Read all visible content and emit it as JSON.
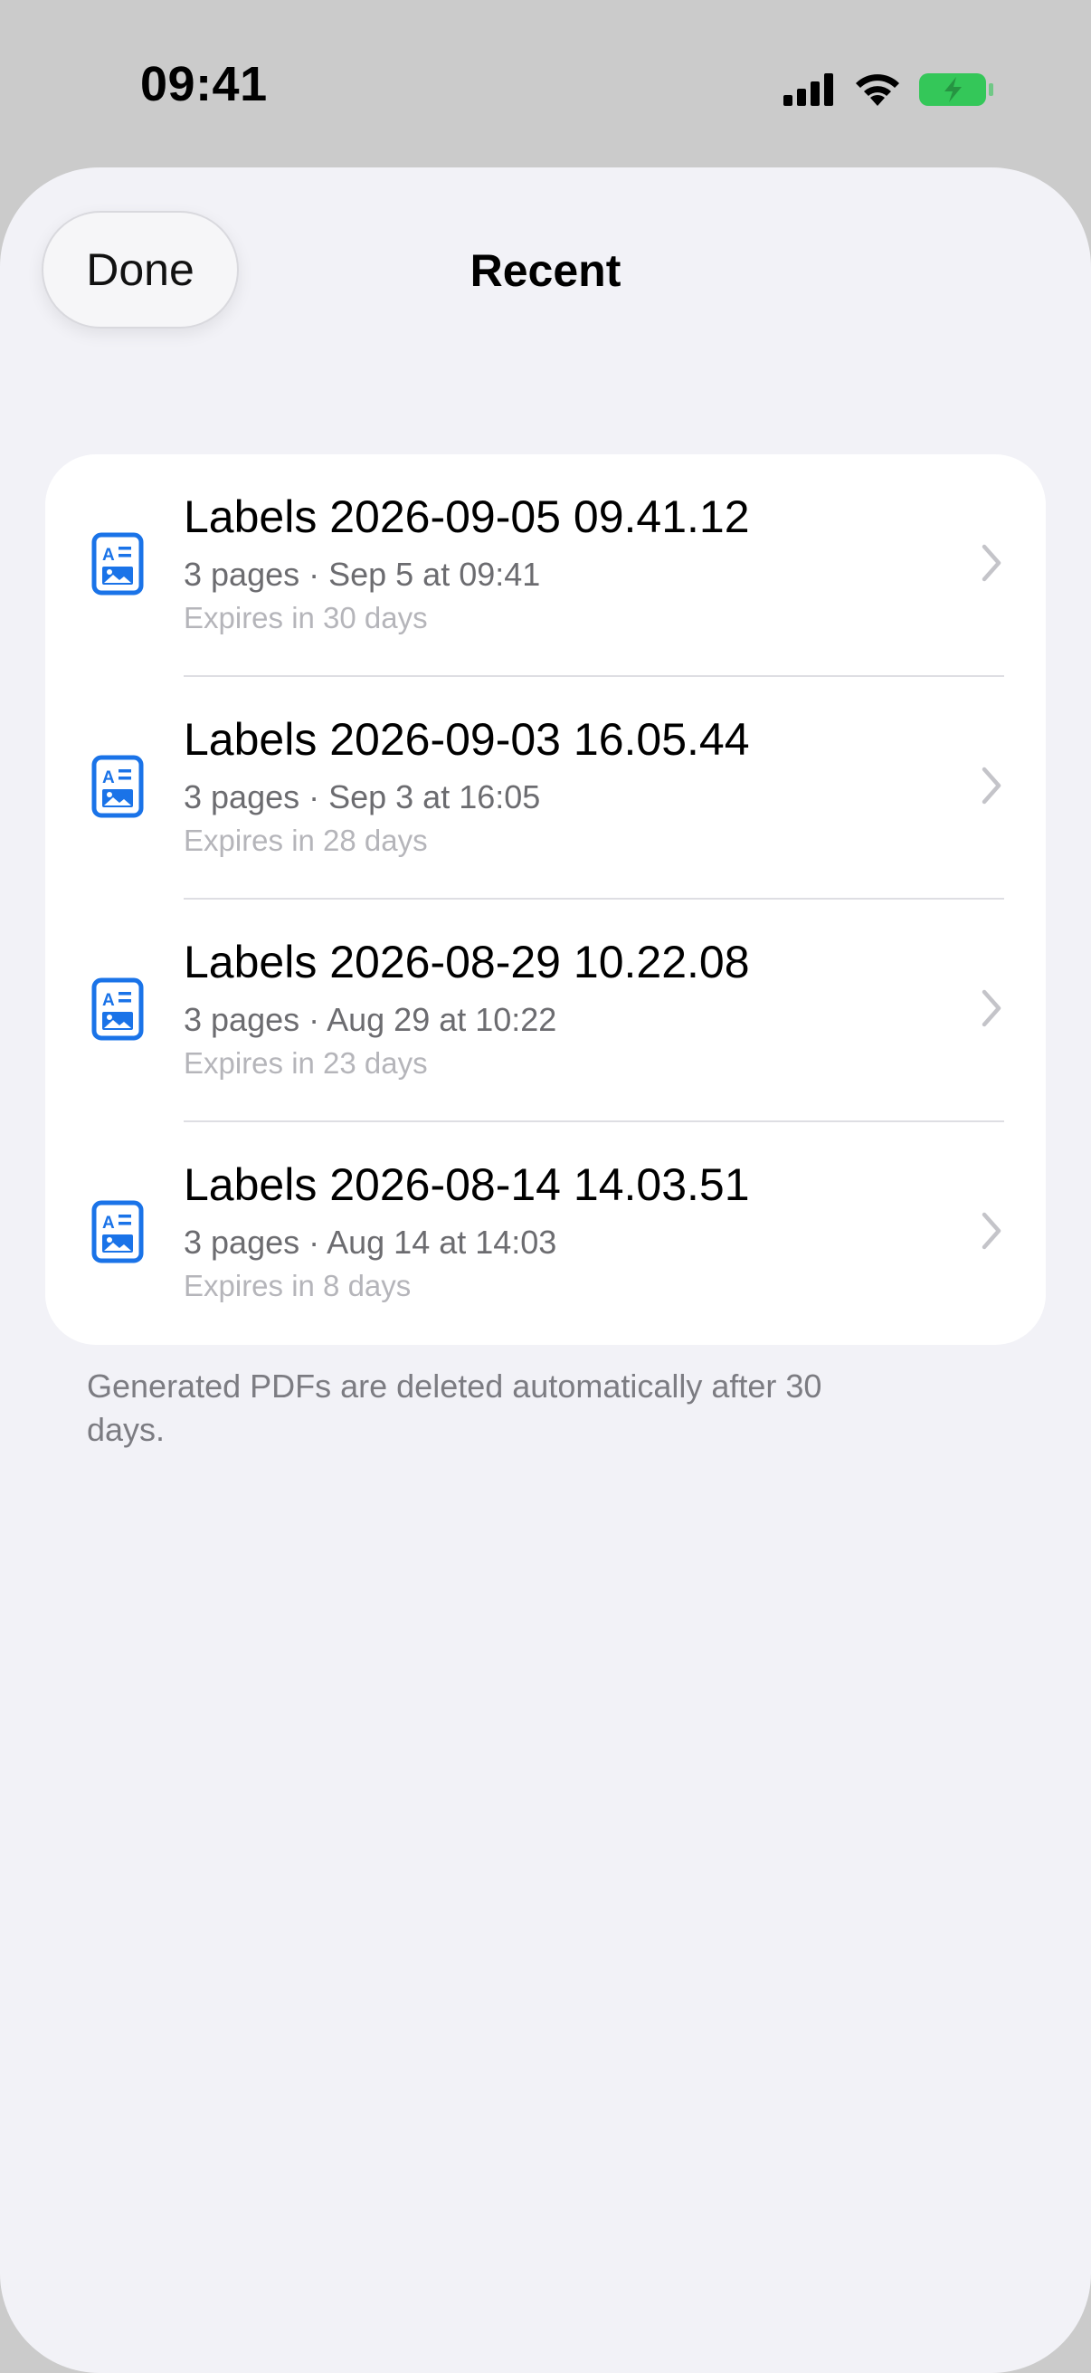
{
  "status_bar": {
    "time": "09:41",
    "battery_color": "#34c759"
  },
  "sheet": {
    "done_label": "Done",
    "title": "Recent"
  },
  "items": [
    {
      "title": "Labels 2026-09-05 09.41.12",
      "subtitle": "3 pages · Sep 5 at 09:41",
      "expiry": "Expires in 30 days"
    },
    {
      "title": "Labels 2026-09-03 16.05.44",
      "subtitle": "3 pages · Sep 3 at 16:05",
      "expiry": "Expires in 28 days"
    },
    {
      "title": "Labels 2026-08-29 10.22.08",
      "subtitle": "3 pages · Aug 29 at 10:22",
      "expiry": "Expires in 23 days"
    },
    {
      "title": "Labels 2026-08-14 14.03.51",
      "subtitle": "3 pages · Aug 14 at 14:03",
      "expiry": "Expires in 8 days"
    }
  ],
  "footer_note": "Generated PDFs are deleted automatically after 30 days.",
  "colors": {
    "accent": "#1a73e8",
    "chevron": "#c4c4c9"
  },
  "icons": {
    "row_icon": "document-richtext-icon",
    "row_chevron": "chevron-right-icon"
  }
}
